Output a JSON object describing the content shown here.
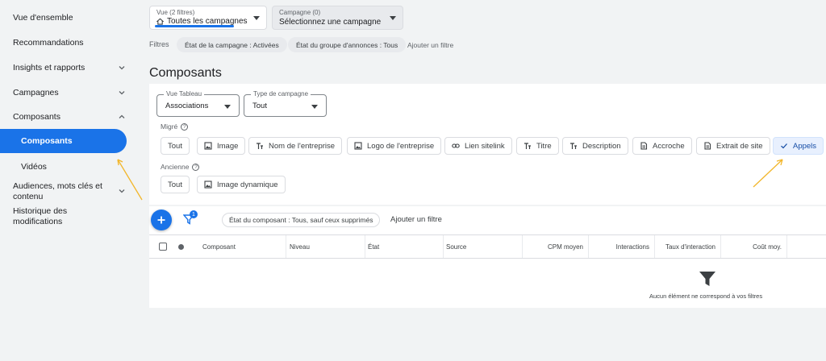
{
  "sidebar": {
    "items": [
      {
        "label": "Vue d'ensemble"
      },
      {
        "label": "Recommandations"
      },
      {
        "label": "Insights et rapports"
      },
      {
        "label": "Campagnes"
      },
      {
        "label": "Composants"
      },
      {
        "label": "Composants"
      },
      {
        "label": "Vidéos"
      },
      {
        "label": "Audiences, mots clés et contenu"
      },
      {
        "label": "Historique des modifications"
      }
    ]
  },
  "header": {
    "view_small": "Vue (2 filtres)",
    "view_main": "Toutes les campagnes",
    "campaign_small": "Campagne (0)",
    "campaign_main": "Sélectionnez une campagne",
    "filters_label": "Filtres",
    "filter_chips": [
      "État de la campagne : Activées",
      "État du groupe d'annonces : Tous"
    ],
    "add_filter": "Ajouter un filtre"
  },
  "page_title": "Composants",
  "controls": {
    "vue_tableau": {
      "label": "Vue Tableau",
      "value": "Associations"
    },
    "type_campagne": {
      "label": "Type de campagne",
      "value": "Tout"
    }
  },
  "migre": {
    "label": "Migré",
    "chips": [
      {
        "label": "Tout",
        "icon": ""
      },
      {
        "label": "Image",
        "icon": "image-icon"
      },
      {
        "label": "Nom de l'entreprise",
        "icon": "text-icon"
      },
      {
        "label": "Logo de l'entreprise",
        "icon": "image-icon"
      },
      {
        "label": "Lien sitelink",
        "icon": "link-icon"
      },
      {
        "label": "Titre",
        "icon": "text-icon"
      },
      {
        "label": "Description",
        "icon": "text-icon"
      },
      {
        "label": "Accroche",
        "icon": "document-icon"
      },
      {
        "label": "Extrait de site",
        "icon": "document-icon"
      },
      {
        "label": "Appels",
        "icon": "check-icon",
        "selected": true
      }
    ]
  },
  "ancienne": {
    "label": "Ancienne",
    "chips": [
      {
        "label": "Tout"
      },
      {
        "label": "Image dynamique"
      }
    ]
  },
  "filterbar": {
    "badge": "1",
    "state_chip": "État du composant : Tous, sauf ceux supprimés",
    "add_filter": "Ajouter un filtre"
  },
  "table": {
    "columns": [
      "Composant",
      "Niveau",
      "État",
      "Source",
      "CPM moyen",
      "Interactions",
      "Taux d'interaction",
      "Coût moy."
    ],
    "empty_text": "Aucun élément ne correspond à vos filtres"
  },
  "colors": {
    "accent": "#1a73e8",
    "annotation_arrow": "#f2b62b"
  }
}
